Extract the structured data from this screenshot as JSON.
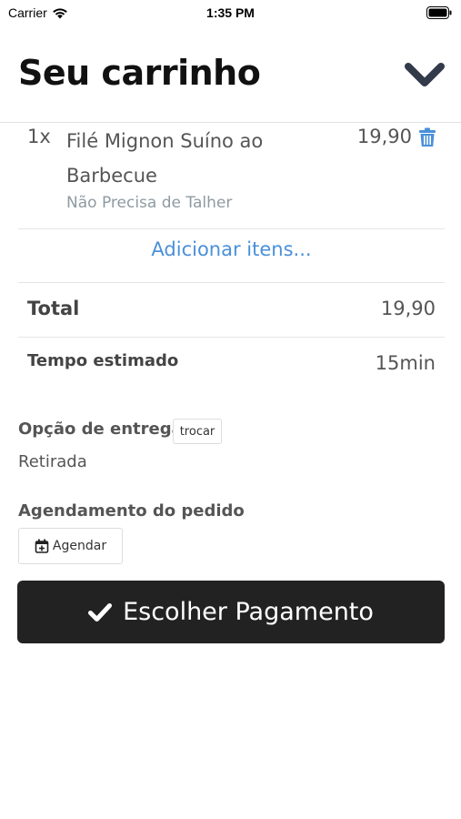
{
  "status_bar": {
    "carrier": "Carrier",
    "time": "1:35 PM"
  },
  "header": {
    "title": "Seu carrinho"
  },
  "cart": {
    "items": [
      {
        "qty": "1x",
        "name": "Filé Mignon Suíno ao Barbecue",
        "note": "Não Precisa de Talher",
        "price": "19,90"
      }
    ],
    "add_items_label": "Adicionar itens..."
  },
  "summary": {
    "total_label": "Total",
    "total_value": "19,90",
    "time_label": "Tempo estimado",
    "time_value": "15min"
  },
  "delivery": {
    "label": "Opção de entrega",
    "change_label": "trocar",
    "value": "Retirada"
  },
  "schedule": {
    "label": "Agendamento do pedido",
    "button_label": "Agendar"
  },
  "payment": {
    "button_label": "Escolher Pagamento"
  },
  "colors": {
    "accent": "#4a90d9",
    "dark_button": "#222222",
    "muted": "#8e9aa2"
  }
}
